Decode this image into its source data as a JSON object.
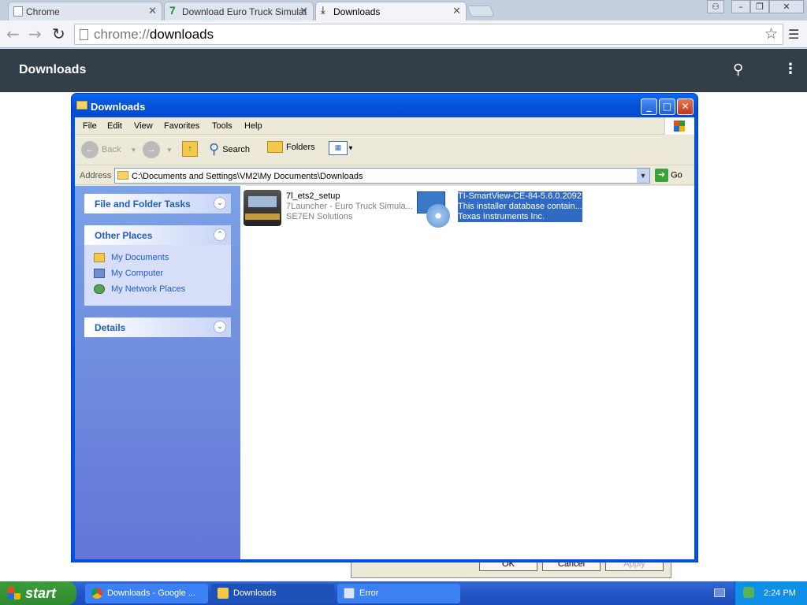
{
  "chrome": {
    "tabs": [
      {
        "title": "Chrome"
      },
      {
        "title": "Download Euro Truck Simulat"
      },
      {
        "title": "Downloads"
      }
    ],
    "url": {
      "scheme": "chrome://",
      "path": "downloads"
    }
  },
  "downloads_page": {
    "title": "Downloads"
  },
  "background_dialog": {
    "buttons": [
      "OK",
      "Cancel",
      "Apply"
    ]
  },
  "explorer": {
    "title": "Downloads",
    "menu": [
      "File",
      "Edit",
      "View",
      "Favorites",
      "Tools",
      "Help"
    ],
    "toolbar": {
      "back": "Back",
      "search": "Search",
      "folders": "Folders"
    },
    "address": {
      "label": "Address",
      "value": "C:\\Documents and Settings\\VM2\\My Documents\\Downloads",
      "go": "Go"
    },
    "task_pane": {
      "file_tasks": "File and Folder Tasks",
      "other_places": {
        "title": "Other Places",
        "links": [
          "My Documents",
          "My Computer",
          "My Network Places"
        ]
      },
      "details": "Details"
    },
    "files": [
      {
        "name": "7l_ets2_setup",
        "desc": "7Launcher - Euro Truck Simula...",
        "company": "SE7EN Solutions",
        "icon": "truck-icon",
        "selected": false
      },
      {
        "name": "TI-SmartView-CE-84-5.6.0.2092",
        "desc": "This installer database contain...",
        "company": "Texas Instruments Inc.",
        "icon": "installer-icon",
        "selected": true
      }
    ]
  },
  "taskbar": {
    "start": "start",
    "tasks": [
      {
        "label": "Downloads - Google ..."
      },
      {
        "label": "Downloads"
      },
      {
        "label": "Error"
      }
    ],
    "clock": "2:24 PM"
  }
}
